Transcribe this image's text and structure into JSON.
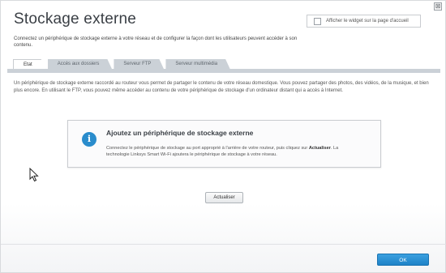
{
  "window": {
    "close_glyph": "⊠"
  },
  "header": {
    "title": "Stockage externe",
    "widget_label": "Afficher le widget sur la page d'accueil",
    "description": "Connectez un périphérique de stockage externe à votre réseau et de configurer la façon dont les utilisateurs peuvent accéder à son contenu."
  },
  "tabs": [
    {
      "label": "Etat",
      "active": true
    },
    {
      "label": "Accès aux dossiers",
      "active": false
    },
    {
      "label": "Serveur FTP",
      "active": false
    },
    {
      "label": "Serveur multimédia",
      "active": false
    }
  ],
  "main": {
    "intro": "Un périphérique de stockage externe raccordé au routeur vous permet de partager le contenu de votre réseau domestique. Vous pouvez partager des photos, des vidéos, de la musique, et bien plus encore. En utilisant le FTP, vous pouvez même accéder au contenu de votre périphérique de stockage d'un ordinateur distant qui a accès à Internet.",
    "card": {
      "icon_glyph": "i",
      "title": "Ajoutez un périphérique de stockage externe",
      "text_part1": "Connectez le périphérique de stockage au port approprié à l'arrière de votre routeur, puis cliquez sur ",
      "text_bold": "Actualiser",
      "text_part2": ". La technologie Linksys Smart Wi-Fi ajoutera le périphérique de stockage à votre réseau."
    },
    "refresh_label": "Actualiser"
  },
  "footer": {
    "ok_label": "OK"
  },
  "colors": {
    "accent": "#2a8ccc",
    "ok_button": "#1f82c7",
    "tab_bg": "#cbd1d7"
  }
}
